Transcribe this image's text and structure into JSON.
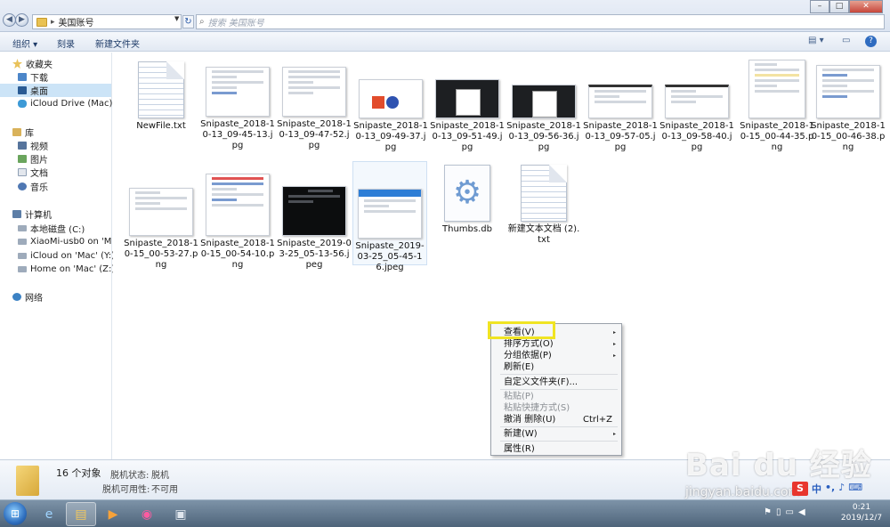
{
  "address": {
    "path": "美国账号",
    "search_placeholder": "搜索 美国账号"
  },
  "toolbar": {
    "organize": "组织 ▾",
    "burn": "刻录",
    "new_folder": "新建文件夹"
  },
  "sidebar": {
    "favorites": "收藏夹",
    "downloads": "下载",
    "desktop": "桌面",
    "icloud_drive": "iCloud Drive (Mac)",
    "libraries": "库",
    "videos": "视频",
    "pictures": "图片",
    "documents": "文档",
    "music": "音乐",
    "computer": "计算机",
    "local_disk": "本地磁盘 (C:)",
    "xiaomi": "XiaoMi-usb0 on 'Ma",
    "icloud_mac": "iCloud on 'Mac' (Y:)",
    "home_mac": "Home on 'Mac' (Z:)",
    "network": "网络"
  },
  "files": [
    {
      "name": "NewFile.txt",
      "kind": "txt"
    },
    {
      "name": "Snipaste_2018-10-13_09-45-13.jpg",
      "kind": "shot-light"
    },
    {
      "name": "Snipaste_2018-10-13_09-47-52.jpg",
      "kind": "shot-light"
    },
    {
      "name": "Snipaste_2018-10-13_09-49-37.jpg",
      "kind": "shot-icons"
    },
    {
      "name": "Snipaste_2018-10-13_09-51-49.jpg",
      "kind": "shot-dark"
    },
    {
      "name": "Snipaste_2018-10-13_09-56-36.jpg",
      "kind": "shot-dark"
    },
    {
      "name": "Snipaste_2018-10-13_09-57-05.jpg",
      "kind": "shot-dark"
    },
    {
      "name": "Snipaste_2018-10-13_09-58-40.jpg",
      "kind": "shot-light"
    },
    {
      "name": "Snipaste_2018-10-15_00-44-35.png",
      "kind": "shot-light"
    },
    {
      "name": "Snipaste_2018-10-15_00-46-38.png",
      "kind": "shot-light"
    },
    {
      "name": "Snipaste_2018-10-15_00-53-27.png",
      "kind": "shot-light"
    },
    {
      "name": "Snipaste_2018-10-15_00-54-10.png",
      "kind": "shot-light"
    },
    {
      "name": "Snipaste_2019-03-25_05-13-56.jpeg",
      "kind": "shot-dark"
    },
    {
      "name": "Snipaste_2019-03-25_05-45-16.jpeg",
      "kind": "shot-blue"
    },
    {
      "name": "Thumbs.db",
      "kind": "db"
    },
    {
      "name": "新建文本文档 (2).txt",
      "kind": "txt"
    }
  ],
  "context_menu": {
    "view": "查看(V)",
    "sort": "排序方式(O)",
    "group": "分组依据(P)",
    "refresh": "刷新(E)",
    "customize": "自定义文件夹(F)...",
    "paste": "粘贴(P)",
    "paste_shortcut": "粘贴快捷方式(S)",
    "undo": "撤消 删除(U)",
    "undo_shortcut": "Ctrl+Z",
    "new": "新建(W)",
    "properties": "属性(R)"
  },
  "details": {
    "count": "16 个对象",
    "offline_status_label": "脱机状态:",
    "offline_status_value": "脱机",
    "offline_avail_label": "脱机可用性:",
    "offline_avail_value": "不可用"
  },
  "taskbar": {
    "time": "0:21",
    "date": "2019/12/7"
  },
  "watermark": {
    "brand": "Bai du 经验",
    "url": "jingyan.baidu.com"
  },
  "ime": {
    "logo": "S",
    "lang": "中"
  }
}
